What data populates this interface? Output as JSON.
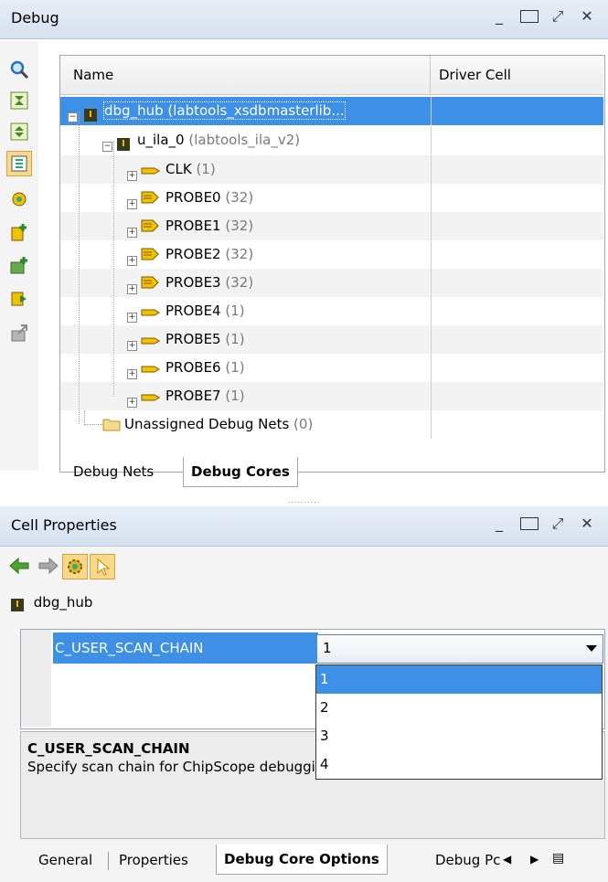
{
  "debug_panel": {
    "title": "Debug",
    "columns": [
      "Name",
      "Driver Cell"
    ],
    "tree": [
      {
        "name": "dbg_hub",
        "detail": "(labtools_xsdbmasterlib...",
        "indent": 0,
        "icon": "chip-icon",
        "expander": "minus"
      },
      {
        "name": "u_ila_0",
        "detail": "(labtools_ila_v2)",
        "indent": 1,
        "icon": "chip-icon",
        "expander": "minus"
      },
      {
        "name": "CLK",
        "detail": "(1)",
        "indent": 2,
        "icon": "net-icon",
        "expander": "plus"
      },
      {
        "name": "PROBE0",
        "detail": "(32)",
        "indent": 2,
        "icon": "bus-icon",
        "expander": "plus"
      },
      {
        "name": "PROBE1",
        "detail": "(32)",
        "indent": 2,
        "icon": "bus-icon",
        "expander": "plus"
      },
      {
        "name": "PROBE2",
        "detail": "(32)",
        "indent": 2,
        "icon": "bus-icon",
        "expander": "plus"
      },
      {
        "name": "PROBE3",
        "detail": "(32)",
        "indent": 2,
        "icon": "bus-icon",
        "expander": "plus"
      },
      {
        "name": "PROBE4",
        "detail": "(1)",
        "indent": 2,
        "icon": "net-icon",
        "expander": "plus"
      },
      {
        "name": "PROBE5",
        "detail": "(1)",
        "indent": 2,
        "icon": "net-icon",
        "expander": "plus"
      },
      {
        "name": "PROBE6",
        "detail": "(1)",
        "indent": 2,
        "icon": "net-icon",
        "expander": "plus"
      },
      {
        "name": "PROBE7",
        "detail": "(1)",
        "indent": 2,
        "icon": "net-icon",
        "expander": "plus"
      },
      {
        "name": "Unassigned Debug Nets",
        "detail": "(0)",
        "indent": 1,
        "icon": "folder-icon",
        "expander": "none"
      }
    ],
    "tabs": [
      "Debug Nets",
      "Debug Cores"
    ],
    "active_tab": "Debug Cores"
  },
  "cell_properties": {
    "title": "Cell Properties",
    "cell_name": "dbg_hub",
    "property_name": "C_USER_SCAN_CHAIN",
    "selected_value": "1",
    "options": [
      "1",
      "2",
      "3",
      "4"
    ],
    "description_title": "C_USER_SCAN_CHAIN",
    "description_text": "Specify scan chain for ChipScope debugging",
    "tabs": [
      "General",
      "Properties",
      "Debug Core Options",
      "Debug Pc"
    ],
    "active_tab": "Debug Core Options"
  },
  "colors": {
    "selection": "#3e8fe6",
    "title_bar": "#dce6f3",
    "toolbar_highlight": "#f7d98c"
  }
}
